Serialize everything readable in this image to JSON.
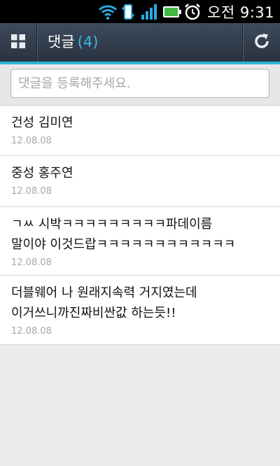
{
  "status_bar": {
    "time": "오전 9:31",
    "icons": [
      "wifi-icon",
      "data-transfer-icon",
      "signal-icon",
      "battery-icon",
      "alarm-icon"
    ]
  },
  "header": {
    "title": "댓글",
    "count": "(4)",
    "menu_icon": "grid-icon",
    "refresh_icon": "refresh-icon"
  },
  "comment_input": {
    "placeholder": "댓글을 등록해주세요.",
    "value": ""
  },
  "comments": [
    {
      "text": "건성 김미연",
      "date": "12.08.08"
    },
    {
      "text": "중성 홍주연",
      "date": "12.08.08"
    },
    {
      "text": "ㄱㅆ 시박ㅋㅋㅋㅋㅋㅋㅋㅋㅋ파데이름\n말이야 이것드랍ㅋㅋㅋㅋㅋㅋㅋㅋㅋㅋㅋㅋ",
      "date": "12.08.08"
    },
    {
      "text": "더블웨어 나 원래지속력 거지였는데\n이거쓰니까진짜비싼값 하는듯!!",
      "date": "12.08.08"
    }
  ],
  "colors": {
    "accent": "#2bb4d9",
    "count": "#36b7e2",
    "header_bg": "#333d4b",
    "background": "#ebebeb"
  }
}
